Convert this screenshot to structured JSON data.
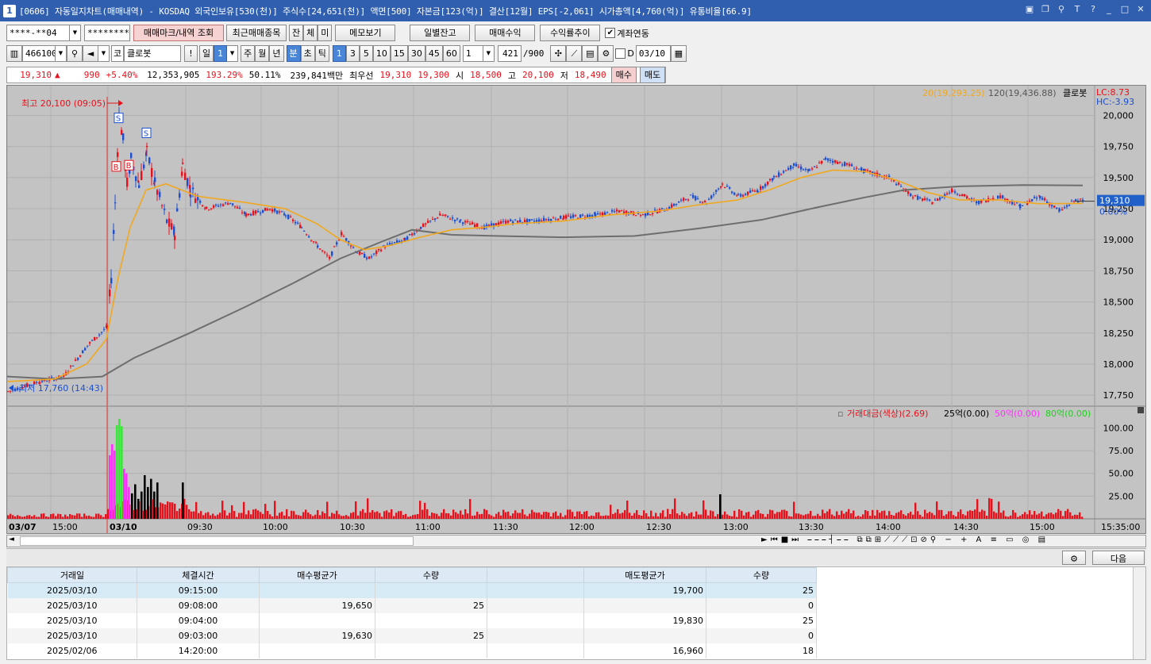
{
  "window": {
    "number": "1",
    "title": "[0606] 자동일지차트(매매내역) - KOSDAQ 외국인보유[530(천)] 주식수[24,651(천)] 액면[500] 자본금[123(억)] 결산[12월] EPS[-2,061] 시가총액[4,760(억)] 유통비율[66.9]"
  },
  "toolbar1": {
    "account": "****-**04",
    "password": "********",
    "trade_mark_btn": "매매마크/내역 조회",
    "recent_btn": "최근매매종목",
    "jan": "잔",
    "che": "체",
    "mi": "미",
    "memo_btn": "메모보기",
    "daily_btn": "일별잔고",
    "profit_btn": "매매수익",
    "rate_btn": "수익률추이",
    "link_label": "계좌연동"
  },
  "toolbar2": {
    "code": "466100",
    "market": "코",
    "name": "클로봇",
    "bang": "!",
    "il": "일",
    "num1": "1",
    "ju": "주",
    "wol": "월",
    "nyeon": "년",
    "bun": "분",
    "cho": "초",
    "tick": "틱",
    "periods": [
      "1",
      "3",
      "5",
      "10",
      "15",
      "30",
      "45",
      "60"
    ],
    "count": "1",
    "bars": "421",
    "bars_total": "/900",
    "d_label": "D",
    "date": "03/10"
  },
  "quote": {
    "price": "19,310",
    "change": "990",
    "change_pct": "+5.40%",
    "volume": "12,353,905",
    "vol_ratio": "193.29%",
    "pct2": "50.11%",
    "amount": "239,841백만",
    "best_label": "최우선",
    "ask": "19,310",
    "bid": "19,300",
    "open_label": "시",
    "open": "18,500",
    "high_label": "고",
    "high": "20,100",
    "low_label": "저",
    "low": "18,490",
    "buy_btn": "매수",
    "sell_btn": "매도"
  },
  "chart_data": [
    {
      "type": "candlestick",
      "legend": [
        "20(19,293.25)",
        "120(19,436.88)",
        "클로봇"
      ],
      "lc": "LC:8.73",
      "hc": "HC:-3.93",
      "current_price": "19,310",
      "current_pct": "0.00%",
      "high_annotation": "최고 20,100 (09:05)",
      "low_annotation": "최저 17,760 (14:43)",
      "y_ticks": [
        "20,000",
        "19,750",
        "19,500",
        "19,250",
        "19,000",
        "18,750",
        "18,500",
        "18,250",
        "18,000",
        "17,750"
      ],
      "x_ticks": [
        "03/07",
        "15:00",
        "03/10",
        "09:30",
        "10:00",
        "10:30",
        "11:00",
        "11:30",
        "12:00",
        "12:30",
        "13:00",
        "13:30",
        "14:00",
        "14:30",
        "15:00",
        "15:35:00"
      ],
      "markers": [
        "S",
        "S",
        "B",
        "B"
      ],
      "ylim": [
        17700,
        20150
      ],
      "price_path": [
        [
          0,
          17780
        ],
        [
          40,
          17860
        ],
        [
          70,
          17900
        ],
        [
          100,
          18150
        ],
        [
          125,
          18300
        ],
        [
          130,
          18700
        ],
        [
          135,
          19300
        ],
        [
          140,
          20000
        ],
        [
          145,
          19800
        ],
        [
          150,
          19450
        ],
        [
          155,
          19650
        ],
        [
          165,
          19450
        ],
        [
          175,
          19700
        ],
        [
          185,
          19450
        ],
        [
          200,
          19150
        ],
        [
          210,
          19050
        ],
        [
          220,
          19600
        ],
        [
          230,
          19400
        ],
        [
          250,
          19250
        ],
        [
          280,
          19300
        ],
        [
          300,
          19200
        ],
        [
          330,
          19250
        ],
        [
          350,
          19200
        ],
        [
          370,
          19100
        ],
        [
          390,
          18950
        ],
        [
          405,
          18850
        ],
        [
          420,
          19050
        ],
        [
          440,
          18900
        ],
        [
          455,
          18850
        ],
        [
          475,
          18950
        ],
        [
          500,
          19000
        ],
        [
          520,
          19100
        ],
        [
          545,
          19200
        ],
        [
          570,
          19150
        ],
        [
          600,
          19100
        ],
        [
          630,
          19150
        ],
        [
          660,
          19150
        ],
        [
          700,
          19180
        ],
        [
          740,
          19200
        ],
        [
          770,
          19230
        ],
        [
          800,
          19200
        ],
        [
          830,
          19250
        ],
        [
          860,
          19350
        ],
        [
          880,
          19300
        ],
        [
          900,
          19450
        ],
        [
          920,
          19350
        ],
        [
          945,
          19400
        ],
        [
          965,
          19500
        ],
        [
          990,
          19600
        ],
        [
          1010,
          19550
        ],
        [
          1030,
          19650
        ],
        [
          1060,
          19600
        ],
        [
          1080,
          19550
        ],
        [
          1110,
          19500
        ],
        [
          1140,
          19350
        ],
        [
          1165,
          19300
        ],
        [
          1190,
          19400
        ],
        [
          1220,
          19300
        ],
        [
          1250,
          19350
        ],
        [
          1275,
          19270
        ],
        [
          1300,
          19350
        ],
        [
          1325,
          19230
        ],
        [
          1345,
          19320
        ],
        [
          1355,
          19310
        ]
      ],
      "ma20_path": [
        [
          0,
          17860
        ],
        [
          60,
          17880
        ],
        [
          100,
          18000
        ],
        [
          125,
          18200
        ],
        [
          140,
          18700
        ],
        [
          155,
          19100
        ],
        [
          175,
          19400
        ],
        [
          200,
          19450
        ],
        [
          240,
          19350
        ],
        [
          300,
          19300
        ],
        [
          350,
          19250
        ],
        [
          390,
          19130
        ],
        [
          420,
          19000
        ],
        [
          450,
          18920
        ],
        [
          480,
          18950
        ],
        [
          520,
          19020
        ],
        [
          560,
          19080
        ],
        [
          600,
          19100
        ],
        [
          640,
          19130
        ],
        [
          700,
          19150
        ],
        [
          760,
          19200
        ],
        [
          820,
          19230
        ],
        [
          870,
          19280
        ],
        [
          920,
          19320
        ],
        [
          960,
          19400
        ],
        [
          1000,
          19500
        ],
        [
          1040,
          19560
        ],
        [
          1080,
          19550
        ],
        [
          1120,
          19480
        ],
        [
          1160,
          19380
        ],
        [
          1200,
          19320
        ],
        [
          1250,
          19320
        ],
        [
          1300,
          19290
        ],
        [
          1355,
          19293
        ]
      ],
      "ma120_path": [
        [
          0,
          17900
        ],
        [
          60,
          17880
        ],
        [
          120,
          17900
        ],
        [
          160,
          18050
        ],
        [
          230,
          18250
        ],
        [
          300,
          18460
        ],
        [
          360,
          18650
        ],
        [
          420,
          18850
        ],
        [
          470,
          18980
        ],
        [
          510,
          19080
        ],
        [
          560,
          19040
        ],
        [
          620,
          19030
        ],
        [
          700,
          19020
        ],
        [
          790,
          19030
        ],
        [
          870,
          19090
        ],
        [
          950,
          19160
        ],
        [
          1020,
          19260
        ],
        [
          1080,
          19340
        ],
        [
          1130,
          19400
        ],
        [
          1200,
          19430
        ],
        [
          1280,
          19440
        ],
        [
          1355,
          19437
        ]
      ]
    },
    {
      "type": "bar",
      "title": "거래대금(색상)(2.69)",
      "legend": [
        "25억(0.00)",
        "50억(0.00)",
        "80억(0.00)"
      ],
      "y_ticks": [
        "100.00",
        "75.00",
        "50.00",
        "25.00"
      ],
      "ylim": [
        0,
        110
      ],
      "spikes": [
        [
          128,
          70,
          "#ff30ff"
        ],
        [
          131,
          82,
          "#ff30ff"
        ],
        [
          134,
          75,
          "#ff30ff"
        ],
        [
          137,
          103,
          "#38e838"
        ],
        [
          140,
          110,
          "#38e838"
        ],
        [
          143,
          102,
          "#38e838"
        ],
        [
          146,
          55,
          "#ff30ff"
        ],
        [
          149,
          50,
          "#ff30ff"
        ],
        [
          152,
          35,
          "#ff30ff"
        ],
        [
          156,
          28,
          "#000000"
        ],
        [
          160,
          38,
          "#000000"
        ],
        [
          164,
          22,
          "#000000"
        ],
        [
          168,
          30,
          "#000000"
        ],
        [
          172,
          48,
          "#000000"
        ],
        [
          176,
          35,
          "#000000"
        ],
        [
          180,
          44,
          "#000000"
        ],
        [
          184,
          30,
          "#000000"
        ],
        [
          188,
          40,
          "#000000"
        ],
        [
          220,
          40,
          "#000000"
        ],
        [
          897,
          27,
          "#000000"
        ]
      ]
    }
  ],
  "table": {
    "headers": [
      "거래일",
      "체결시간",
      "매수평균가",
      "수량",
      "",
      "매도평균가",
      "수량"
    ],
    "rows": [
      [
        "2025/03/10",
        "09:15:00",
        "",
        "",
        "",
        "19,700",
        "25"
      ],
      [
        "2025/03/10",
        "09:08:00",
        "19,650",
        "25",
        "",
        "",
        "0"
      ],
      [
        "2025/03/10",
        "09:04:00",
        "",
        "",
        "",
        "19,830",
        "25"
      ],
      [
        "2025/03/10",
        "09:03:00",
        "19,630",
        "25",
        "",
        "",
        "0"
      ],
      [
        "2025/02/06",
        "14:20:00",
        "",
        "",
        "",
        "16,960",
        "18"
      ]
    ]
  },
  "bottom": {
    "next_btn": "다음"
  }
}
